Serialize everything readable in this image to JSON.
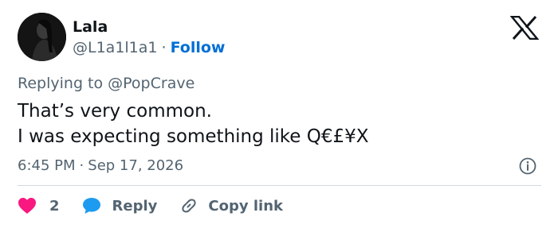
{
  "author": {
    "display_name": "Lala",
    "handle": "@L1a1l1a1",
    "separator": "·",
    "follow_label": "Follow"
  },
  "reply_context": {
    "prefix": "Replying to ",
    "mention": "@PopCrave"
  },
  "tweet": {
    "lines": [
      "That’s very common.",
      "I was expecting something like Q€£¥X"
    ]
  },
  "meta": {
    "time": "6:45 PM",
    "separator": "·",
    "date": "Sep 17, 2026"
  },
  "actions": {
    "like_count": "2",
    "reply_label": "Reply",
    "copy_link_label": "Copy link"
  },
  "icons": {
    "brand": "x-logo-icon",
    "like": "heart-icon",
    "reply": "speech-bubble-icon",
    "copy": "link-icon",
    "info": "info-icon"
  },
  "colors": {
    "text_primary": "#0f1419",
    "text_secondary": "#536471",
    "link_blue": "#006fd6",
    "heart_pink": "#f91880",
    "reply_blue": "#1d9bf0",
    "divider": "#cfd9de"
  }
}
